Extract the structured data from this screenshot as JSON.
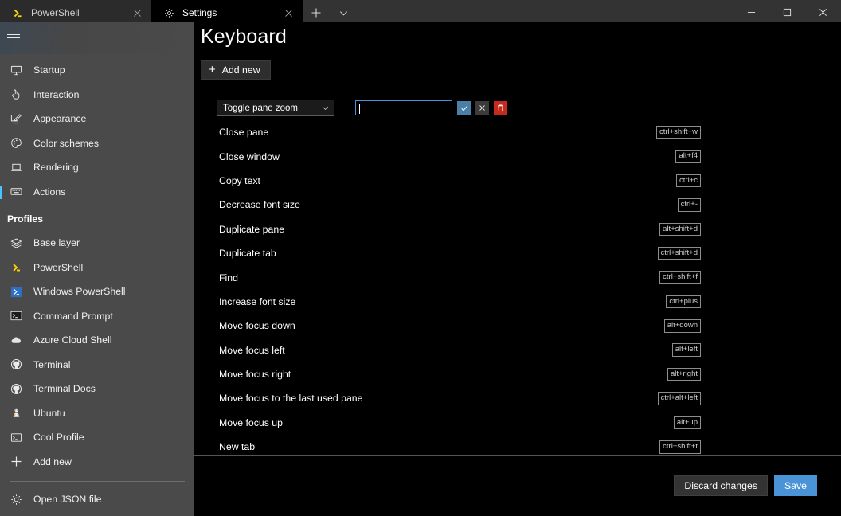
{
  "window": {
    "tabs": [
      {
        "label": "PowerShell",
        "icon": "powershell-icon",
        "active": false
      },
      {
        "label": "Settings",
        "icon": "gear-icon",
        "active": true
      }
    ],
    "new_tab_label": "+",
    "tab_dropdown_label": "v",
    "controls": {
      "minimize": "minimize-icon",
      "maximize": "maximize-icon",
      "close": "close-icon"
    }
  },
  "sidebar": {
    "menu_icon": "hamburger-icon",
    "items": [
      {
        "label": "Startup",
        "icon": "monitor-icon",
        "selected": false
      },
      {
        "label": "Interaction",
        "icon": "cursor-hand-icon",
        "selected": false
      },
      {
        "label": "Appearance",
        "icon": "pencil-screen-icon",
        "selected": false
      },
      {
        "label": "Color schemes",
        "icon": "palette-icon",
        "selected": false
      },
      {
        "label": "Rendering",
        "icon": "laptop-icon",
        "selected": false
      },
      {
        "label": "Actions",
        "icon": "keyboard-icon",
        "selected": true
      }
    ],
    "profiles_header": "Profiles",
    "profiles": [
      {
        "label": "Base layer",
        "icon": "layers-icon"
      },
      {
        "label": "PowerShell",
        "icon": "powershell-icon"
      },
      {
        "label": "Windows PowerShell",
        "icon": "windows-powershell-icon"
      },
      {
        "label": "Command Prompt",
        "icon": "command-prompt-icon"
      },
      {
        "label": "Azure Cloud Shell",
        "icon": "cloud-icon"
      },
      {
        "label": "Terminal",
        "icon": "github-icon"
      },
      {
        "label": "Terminal Docs",
        "icon": "github-icon"
      },
      {
        "label": "Ubuntu",
        "icon": "ubuntu-icon"
      },
      {
        "label": "Cool Profile",
        "icon": "terminal-window-icon"
      },
      {
        "label": "Add new",
        "icon": "plus-icon"
      }
    ],
    "open_json": {
      "label": "Open JSON file",
      "icon": "gear-icon"
    }
  },
  "main": {
    "title": "Keyboard",
    "add_new_label": "Add new",
    "add_new_icon": "plus-icon",
    "edit_row": {
      "action_selected": "Toggle pane zoom",
      "dropdown_icon": "chevron-down-icon",
      "keys_value": "",
      "keys_placeholder": "",
      "accept_icon": "check-icon",
      "cancel_icon": "close-icon",
      "delete_icon": "trash-icon",
      "accept_color": "#4a7fa8",
      "cancel_color": "#3b3b3b",
      "delete_color": "#c42b1c"
    },
    "actions": [
      {
        "name": "Close pane",
        "keys": "ctrl+shift+w"
      },
      {
        "name": "Close window",
        "keys": "alt+f4"
      },
      {
        "name": "Copy text",
        "keys": "ctrl+c"
      },
      {
        "name": "Decrease font size",
        "keys": "ctrl+-"
      },
      {
        "name": "Duplicate pane",
        "keys": "alt+shift+d"
      },
      {
        "name": "Duplicate tab",
        "keys": "ctrl+shift+d"
      },
      {
        "name": "Find",
        "keys": "ctrl+shift+f"
      },
      {
        "name": "Increase font size",
        "keys": "ctrl+plus"
      },
      {
        "name": "Move focus down",
        "keys": "alt+down"
      },
      {
        "name": "Move focus left",
        "keys": "alt+left"
      },
      {
        "name": "Move focus right",
        "keys": "alt+right"
      },
      {
        "name": "Move focus to the last used pane",
        "keys": "ctrl+alt+left"
      },
      {
        "name": "Move focus up",
        "keys": "alt+up"
      },
      {
        "name": "New tab",
        "keys": "ctrl+shift+t"
      }
    ]
  },
  "footer": {
    "discard_label": "Discard changes",
    "save_label": "Save",
    "save_color": "#4a93d6"
  }
}
